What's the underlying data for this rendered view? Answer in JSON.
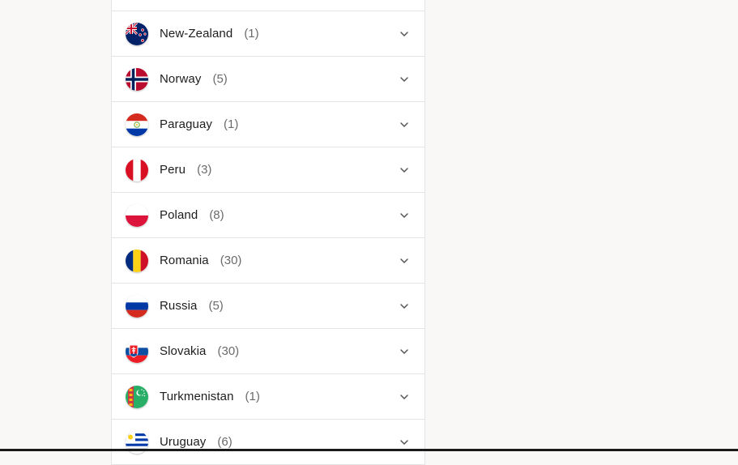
{
  "countries": [
    {
      "name": "New-Zealand",
      "count": "(1)",
      "flag": "new-zealand-flag-icon"
    },
    {
      "name": "Norway",
      "count": "(5)",
      "flag": "norway-flag-icon"
    },
    {
      "name": "Paraguay",
      "count": "(1)",
      "flag": "paraguay-flag-icon"
    },
    {
      "name": "Peru",
      "count": "(3)",
      "flag": "peru-flag-icon"
    },
    {
      "name": "Poland",
      "count": "(8)",
      "flag": "poland-flag-icon"
    },
    {
      "name": "Romania",
      "count": "(30)",
      "flag": "romania-flag-icon"
    },
    {
      "name": "Russia",
      "count": "(5)",
      "flag": "russia-flag-icon"
    },
    {
      "name": "Slovakia",
      "count": "(30)",
      "flag": "slovakia-flag-icon"
    },
    {
      "name": "Turkmenistan",
      "count": "(1)",
      "flag": "turkmenistan-flag-icon"
    },
    {
      "name": "Uruguay",
      "count": "(6)",
      "flag": "uruguay-flag-icon"
    }
  ],
  "colors": {
    "text": "#1d1d1f",
    "count": "#6b6b6b",
    "border": "#e4e4e4",
    "background": "#f9f8f6"
  }
}
